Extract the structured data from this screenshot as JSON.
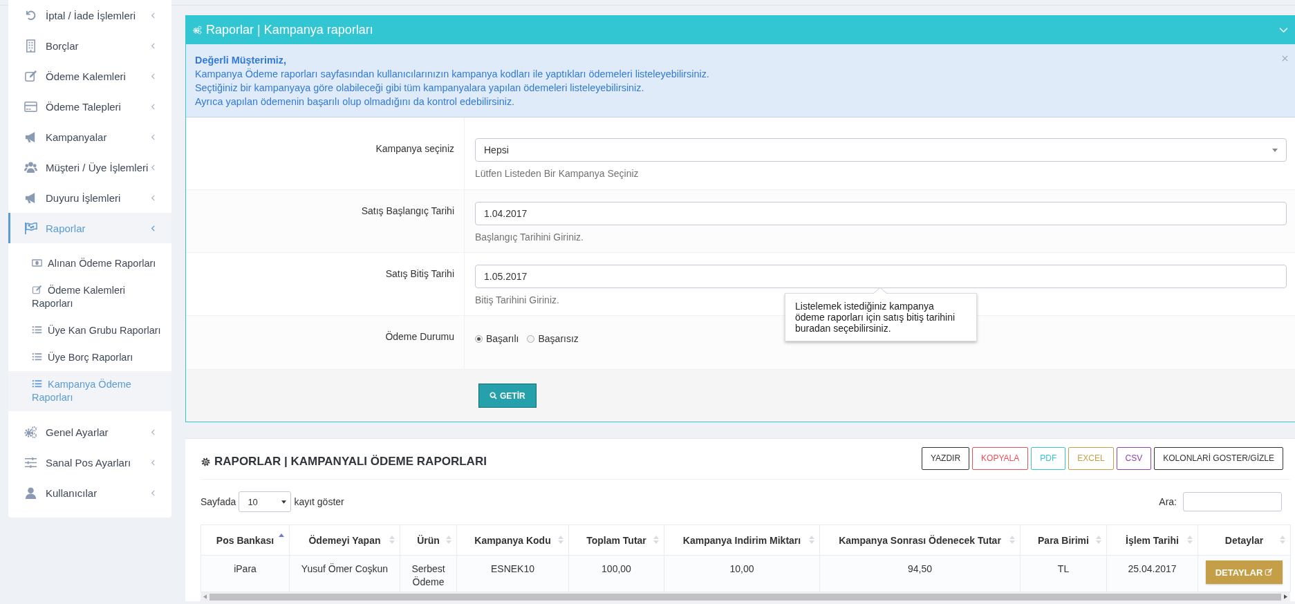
{
  "sidebar": {
    "items": [
      {
        "label": "İptal / İade İşlemleri",
        "selected": false
      },
      {
        "label": "Borçlar",
        "selected": false
      },
      {
        "label": "Ödeme Kalemleri",
        "selected": false
      },
      {
        "label": "Ödeme Talepleri",
        "selected": false
      },
      {
        "label": "Kampanyalar",
        "selected": false
      },
      {
        "label": "Müşteri / Üye İşlemleri",
        "selected": false
      },
      {
        "label": "Duyuru İşlemleri",
        "selected": false
      },
      {
        "label": "Raporlar",
        "selected": true,
        "children": [
          {
            "label": "Alınan Ödeme Raporları",
            "selected": false
          },
          {
            "label": "Ödeme Kalemleri Raporları",
            "selected": false
          },
          {
            "label": "Üye Kan Grubu Raporları",
            "selected": false
          },
          {
            "label": "Üye Borç Raporları",
            "selected": false
          },
          {
            "label": "Kampanya Ödeme Raporları",
            "selected": true
          }
        ]
      },
      {
        "label": "Genel Ayarlar",
        "selected": false
      },
      {
        "label": "Sanal Pos Ayarları",
        "selected": false
      },
      {
        "label": "Kullanıcılar",
        "selected": false
      }
    ]
  },
  "filter_panel": {
    "title": "Raporlar | Kampanya raporları",
    "notice": {
      "heading": "Değerli Müşterimiz,",
      "lines": [
        "Kampanya Ödeme raporları sayfasından kullanıcılarınızın kampanya kodları ile yaptıkları ödemeleri listeleyebilirsiniz.",
        "Seçtiğiniz bir kampanyaya göre olabileceği gibi tüm kampanyalara yapılan ödemeleri listeleyebilirsiniz.",
        "Ayrıca yapılan ödemenin başarılı olup olmadığını da kontrol edebilirsiniz."
      ]
    },
    "fields": [
      {
        "kind": "select",
        "label": "Kampanya seçiniz",
        "value": "Hepsi",
        "help": "Lütfen Listeden Bir Kampanya Seçiniz"
      },
      {
        "kind": "input",
        "label": "Satış Başlangıç Tarihi",
        "value": "1.04.2017",
        "help": "Başlangıç Tarihini Giriniz."
      },
      {
        "kind": "input",
        "label": "Satış Bitiş Tarihi",
        "value": "1.05.2017",
        "help": "Bitiş Tarihini Giriniz.",
        "tooltip": "Listelemek istediğiniz kampanya ödeme raporları için satış bitiş tarihini buradan seçebilirsiniz."
      },
      {
        "kind": "radio",
        "label": "Ödeme Durumu",
        "options": [
          {
            "label": "Başarılı",
            "selected": true
          },
          {
            "label": "Başarısız",
            "selected": false
          }
        ]
      }
    ],
    "submit": "GETİR"
  },
  "report_panel": {
    "title": "RAPORLAR | KAMPANYALI ÖDEME RAPORLARI",
    "export_buttons": [
      {
        "label": "YAZDIR",
        "color": "#333333"
      },
      {
        "label": "KOPYALA",
        "color": "#e7505a"
      },
      {
        "label": "PDF",
        "color": "#32c5d2"
      },
      {
        "label": "EXCEL",
        "color": "#c49f47"
      },
      {
        "label": "CSV",
        "color": "#8e44ad"
      },
      {
        "label": "KOLONLARİ GOSTER/GİZLE",
        "color": "#333333"
      }
    ],
    "length": {
      "prefix": "Sayfada",
      "value": "10",
      "suffix": "kayıt göster"
    },
    "search": {
      "label": "Ara:"
    },
    "table": {
      "columns": [
        {
          "label": "Pos Bankası",
          "sorted": true
        },
        {
          "label": "Ödemeyi Yapan",
          "sorted": false
        },
        {
          "label": "Ürün",
          "sorted": false
        },
        {
          "label": "Kampanya Kodu",
          "sorted": false
        },
        {
          "label": "Toplam Tutar",
          "sorted": false
        },
        {
          "label": "Kampanya Indirim Miktarı",
          "sorted": false
        },
        {
          "label": "Kampanya Sonrası Ödenecek Tutar",
          "sorted": false
        },
        {
          "label": "Para Birimi",
          "sorted": false
        },
        {
          "label": "İşlem Tarihi",
          "sorted": false
        },
        {
          "label": "Detaylar",
          "sorted": false
        }
      ],
      "rows": [
        {
          "cells": [
            "iPara",
            "Yusuf Ömer Coşkun",
            "Serbest Ödeme",
            "ESNEK10",
            "100,00",
            "10,00",
            "94,50",
            "TL",
            "25.04.2017"
          ],
          "action": "DETAYLAR"
        }
      ]
    }
  }
}
